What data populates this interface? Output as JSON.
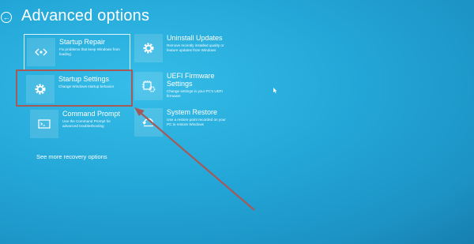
{
  "page": {
    "title": "Advanced options",
    "back_glyph": "←",
    "more_link": "See more recovery options"
  },
  "options": {
    "startup_repair": {
      "label": "Startup Repair",
      "description": "Fix problems that keep Windows from\nloading",
      "icon": "repair-icon"
    },
    "startup_settings": {
      "label": "Startup Settings",
      "description": "Change Windows startup behavior",
      "icon": "gear-icon"
    },
    "command_prompt": {
      "label": "Command Prompt",
      "description": "Use the Command Prompt for\nadvanced troubleshooting",
      "icon": "command-prompt-icon"
    },
    "uninstall_updates": {
      "label": "Uninstall Updates",
      "description": "Remove recently installed quality or\nfeature updates from Windows",
      "icon": "gear-icon"
    },
    "uefi_firmware": {
      "label": "UEFI Firmware\nSettings",
      "description": "Change settings in your PC's UEFI\nfirmware",
      "icon": "firmware-chip-icon"
    },
    "system_restore": {
      "label": "System Restore",
      "description": "Use a restore point recorded on your\nPC to restore Windows",
      "icon": "restore-icon"
    }
  },
  "colors": {
    "background": "#23a7d8",
    "tile": "#ffffff",
    "annotation": "#a55a5a"
  }
}
